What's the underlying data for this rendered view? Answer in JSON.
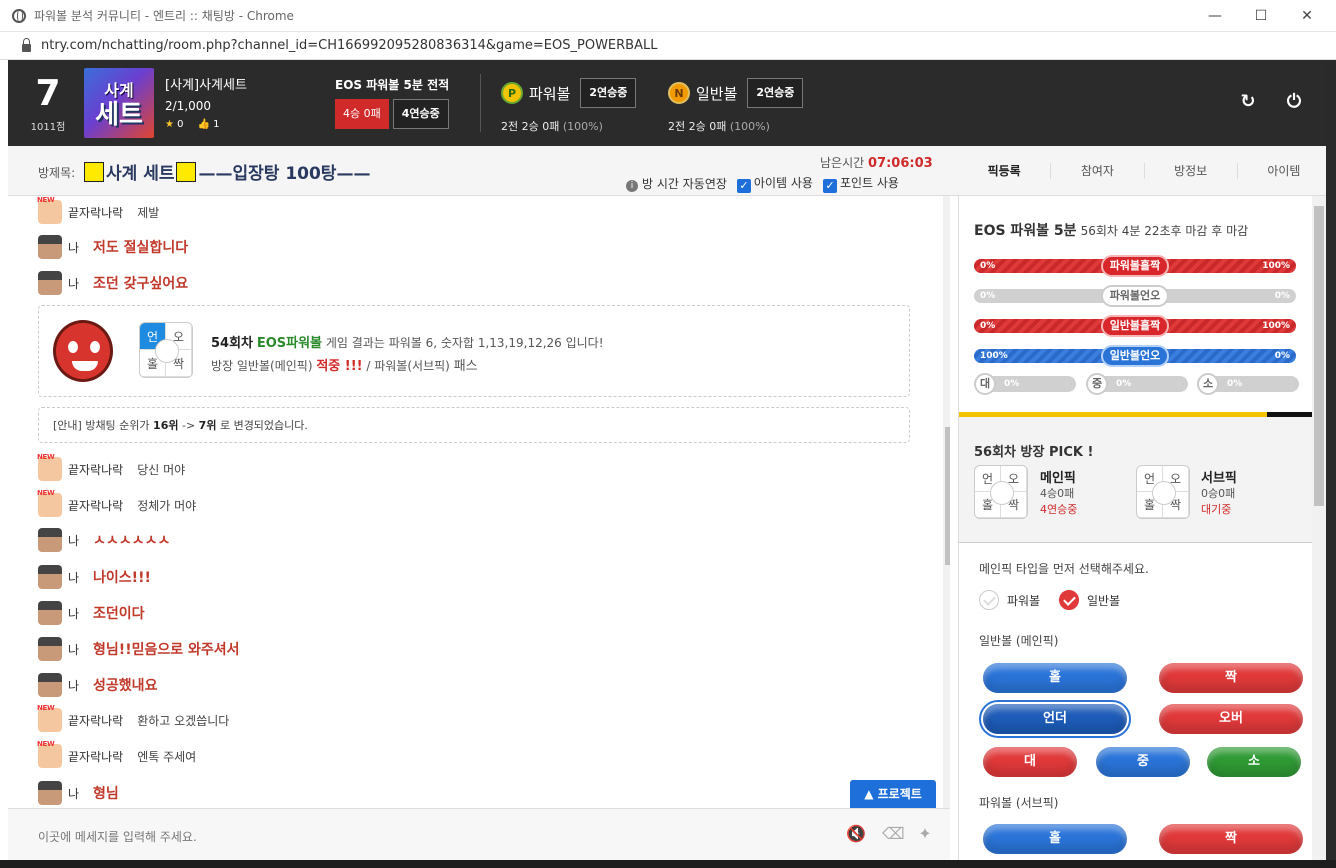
{
  "window": {
    "title": "파워볼 분석 커뮤니티 - 엔트리 :: 채팅방 - Chrome",
    "url": "ntry.com/nchatting/room.php?channel_id=CH166992095280836314&game=EOS_POWERBALL"
  },
  "header": {
    "rank": "7",
    "points": "1011점",
    "logo_line1": "사계",
    "logo_line2": "세트",
    "room_name": "[사계]사계세트",
    "member_count": "2/1,000",
    "stars": "0",
    "likes": "1",
    "eos_title": "EOS 파워볼 5분 전적",
    "eos_record": "4승 0패",
    "eos_streak": "4연승중",
    "powerball": {
      "icon": "P",
      "name": "파워볼",
      "streak": "2연승중",
      "summary": "2전 2승 0패",
      "pct": "(100%)"
    },
    "normalball": {
      "icon": "N",
      "name": "일반볼",
      "streak": "2연승중",
      "summary": "2전 2승 0패",
      "pct": "(100%)"
    },
    "refresh_glyph": "↻",
    "power_glyph": "⏻"
  },
  "roombar": {
    "label": "방제목:",
    "title": "사계 세트",
    "title_suffix": "——입장탕 100탕——",
    "remain_label": "남은시간",
    "remain_time": "07:06:03",
    "opt_autoextend": "방 시간 자동연장",
    "opt_item": "아이템 사용",
    "opt_point": "포인트 사용",
    "tabs": [
      "픽등록",
      "참여자",
      "방정보",
      "아이템"
    ]
  },
  "chat": {
    "messages_top": [
      {
        "type": "new",
        "user": "끝자락나락",
        "text": "제발"
      },
      {
        "type": "me",
        "user": "나",
        "text": "저도 절실합니다"
      },
      {
        "type": "me",
        "user": "나",
        "text": "조던 갖구싶어요"
      }
    ],
    "result": {
      "round": "54회차",
      "game": "EOS파워볼",
      "text1": "게임 결과는 파워볼 6, 숫자합 1,13,19,12,26 입니다!",
      "line2_prefix": "방장 일반볼(메인픽)",
      "hit": "적중 !!!",
      "line2_mid": "/ 파워볼(서브픽)",
      "pass": "패스",
      "pick": [
        "언",
        "오",
        "홀",
        "짝"
      ]
    },
    "notice": {
      "prefix": "[안내] 방채팅 순위가",
      "from": "16위",
      "arrow": "->",
      "to": "7위",
      "suffix": "로 변경되었습니다."
    },
    "messages_bottom": [
      {
        "type": "new",
        "user": "끝자락나락",
        "text": "당신 머야"
      },
      {
        "type": "new",
        "user": "끝자락나락",
        "text": "정체가 머야"
      },
      {
        "type": "me",
        "user": "나",
        "text": "ㅅㅅㅅㅅㅅㅅ"
      },
      {
        "type": "me",
        "user": "나",
        "text": "나이스!!!"
      },
      {
        "type": "me",
        "user": "나",
        "text": "조던이다"
      },
      {
        "type": "me",
        "user": "나",
        "text": "형님!!믿음으로 와주셔서"
      },
      {
        "type": "me",
        "user": "나",
        "text": "성공했내요"
      },
      {
        "type": "new",
        "user": "끝자락나락",
        "text": "환하고 오겠씁니다"
      },
      {
        "type": "new",
        "user": "끝자락나락",
        "text": "엔톡 주세여"
      },
      {
        "type": "me",
        "user": "나",
        "text": "형님"
      }
    ],
    "project_button": "▲ 프로젝트",
    "input_placeholder": "이곳에 메세지를 입력해 주세요."
  },
  "panel": {
    "game": "EOS 파워볼 5분",
    "round_info": "56회차 4분 22초후 마감 후 마감",
    "bars": [
      {
        "label": "파워볼홀짝",
        "left": "0%",
        "right": "100%",
        "fill": 1.0,
        "color": "red",
        "label_style": "r"
      },
      {
        "label": "파워볼언오",
        "left": "0%",
        "right": "0%",
        "fill": 0.0,
        "color": "red",
        "label_style": ""
      },
      {
        "label": "일반볼홀짝",
        "left": "0%",
        "right": "100%",
        "fill": 1.0,
        "color": "red",
        "label_style": "r"
      },
      {
        "label": "일반볼언오",
        "left": "100%",
        "right": "0%",
        "fill": 1.0,
        "color": "blue",
        "label_style": "b"
      }
    ],
    "minis": [
      {
        "label": "대",
        "pct": "0%"
      },
      {
        "label": "중",
        "pct": "0%"
      },
      {
        "label": "소",
        "pct": "0%"
      }
    ],
    "pick_title": "56회차 방장 PICK !",
    "main_pick": {
      "name": "메인픽",
      "record": "4승0패",
      "status": "4연승중",
      "cells": [
        "언",
        "오",
        "홀",
        "짝"
      ]
    },
    "sub_pick": {
      "name": "서브픽",
      "record": "0승0패",
      "status": "대기중",
      "cells": [
        "언",
        "오",
        "홀",
        "짝"
      ]
    },
    "guide": "메인픽 타입을 먼저 선택해주세요.",
    "radio_powerball": "파워볼",
    "radio_normalball": "일반볼",
    "normal_section": "일반볼 (메인픽)",
    "power_section": "파워볼 (서브픽)",
    "btn_odd": "홀",
    "btn_even": "짝",
    "btn_under": "언더",
    "btn_over": "오버",
    "btn_big": "대",
    "btn_mid": "중",
    "btn_small": "소",
    "btn_odd2": "홀",
    "btn_even2": "짝"
  },
  "colors": {
    "header_bg": "#2b2b2b",
    "accent_red": "#d12a2a",
    "accent_blue": "#1e6fd9",
    "highlight_yellow": "#ffea00",
    "powerball_icon": "#f2c400",
    "normalball_icon": "#f29b00"
  }
}
